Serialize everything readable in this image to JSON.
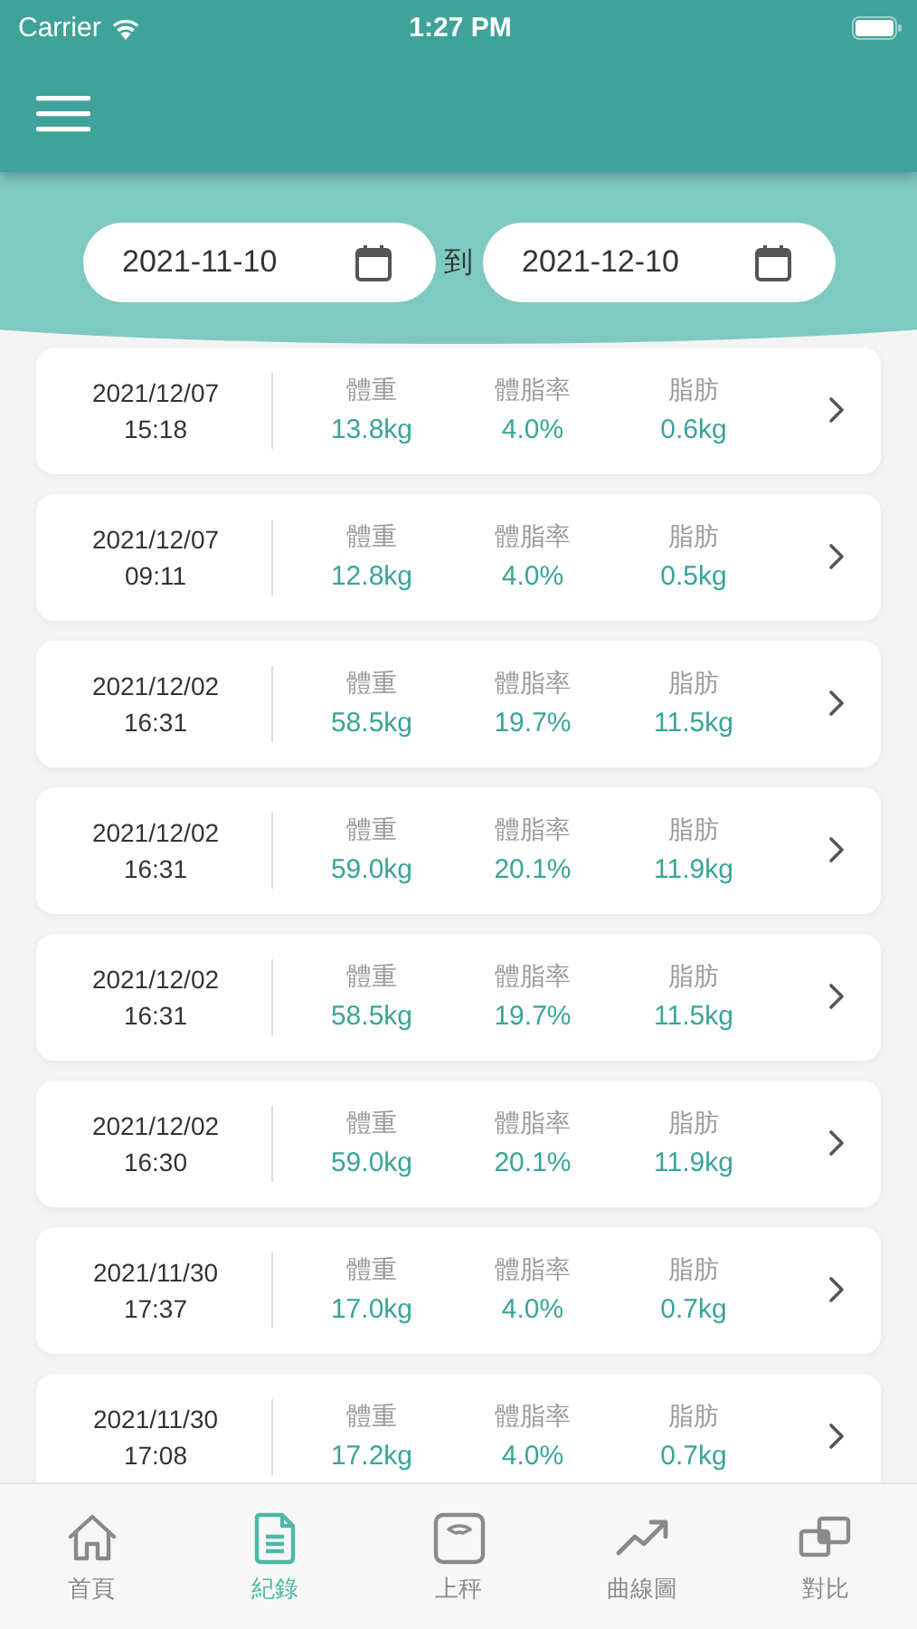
{
  "status_bar": {
    "carrier": "Carrier",
    "time": "1:27 PM"
  },
  "date_range": {
    "start": "2021-11-10",
    "separator": "到",
    "end": "2021-12-10"
  },
  "records": [
    {
      "date": "2021/12/07",
      "time": "15:18",
      "metrics": [
        {
          "label": "體重",
          "value": "13.8kg"
        },
        {
          "label": "體脂率",
          "value": "4.0%"
        },
        {
          "label": "脂肪",
          "value": "0.6kg"
        }
      ]
    },
    {
      "date": "2021/12/07",
      "time": "09:11",
      "metrics": [
        {
          "label": "體重",
          "value": "12.8kg"
        },
        {
          "label": "體脂率",
          "value": "4.0%"
        },
        {
          "label": "脂肪",
          "value": "0.5kg"
        }
      ]
    },
    {
      "date": "2021/12/02",
      "time": "16:31",
      "metrics": [
        {
          "label": "體重",
          "value": "58.5kg"
        },
        {
          "label": "體脂率",
          "value": "19.7%"
        },
        {
          "label": "脂肪",
          "value": "11.5kg"
        }
      ]
    },
    {
      "date": "2021/12/02",
      "time": "16:31",
      "metrics": [
        {
          "label": "體重",
          "value": "59.0kg"
        },
        {
          "label": "體脂率",
          "value": "20.1%"
        },
        {
          "label": "脂肪",
          "value": "11.9kg"
        }
      ]
    },
    {
      "date": "2021/12/02",
      "time": "16:31",
      "metrics": [
        {
          "label": "體重",
          "value": "58.5kg"
        },
        {
          "label": "體脂率",
          "value": "19.7%"
        },
        {
          "label": "脂肪",
          "value": "11.5kg"
        }
      ]
    },
    {
      "date": "2021/12/02",
      "time": "16:30",
      "metrics": [
        {
          "label": "體重",
          "value": "59.0kg"
        },
        {
          "label": "體脂率",
          "value": "20.1%"
        },
        {
          "label": "脂肪",
          "value": "11.9kg"
        }
      ]
    },
    {
      "date": "2021/11/30",
      "time": "17:37",
      "metrics": [
        {
          "label": "體重",
          "value": "17.0kg"
        },
        {
          "label": "體脂率",
          "value": "4.0%"
        },
        {
          "label": "脂肪",
          "value": "0.7kg"
        }
      ]
    },
    {
      "date": "2021/11/30",
      "time": "17:08",
      "metrics": [
        {
          "label": "體重",
          "value": "17.2kg"
        },
        {
          "label": "體脂率",
          "value": "4.0%"
        },
        {
          "label": "脂肪",
          "value": "0.7kg"
        }
      ]
    }
  ],
  "tab_bar": [
    {
      "kind": "home",
      "label": "首頁",
      "selected": false
    },
    {
      "kind": "records",
      "label": "紀錄",
      "selected": true
    },
    {
      "kind": "scale",
      "label": "上秤",
      "selected": false
    },
    {
      "kind": "trend",
      "label": "曲線圖",
      "selected": false
    },
    {
      "kind": "compare",
      "label": "對比",
      "selected": false
    }
  ]
}
